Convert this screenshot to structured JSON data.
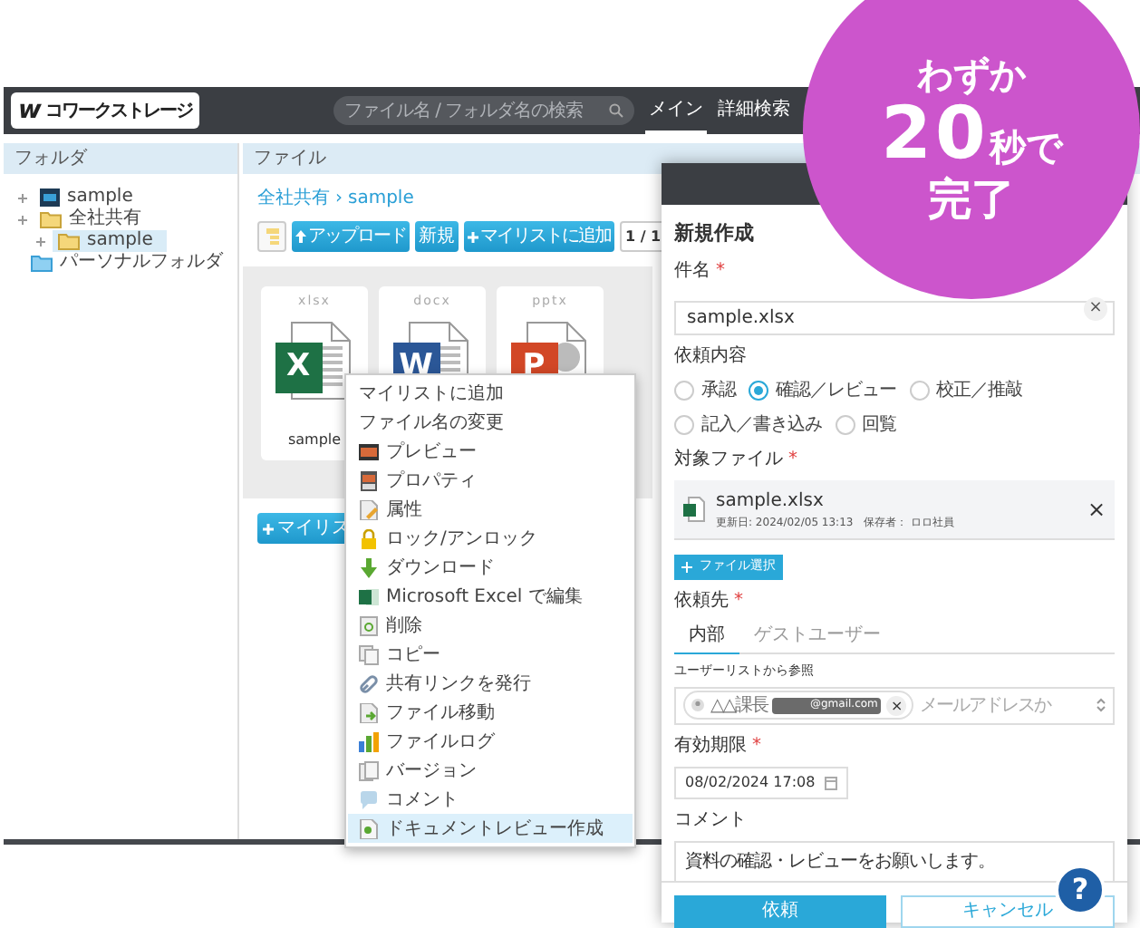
{
  "app": {
    "logo_mark": "w",
    "logo": "コワークストレージ",
    "search": {
      "placeholder": "ファイル名 / フォルダ名の検索"
    },
    "nav_tabs": [
      {
        "label": "メイン",
        "selected": true
      },
      {
        "label": "詳細検索",
        "selected": false
      }
    ]
  },
  "folder_panel": {
    "title": "フォルダ",
    "tree": [
      {
        "label": "sample",
        "kind": "root",
        "selected": false
      },
      {
        "label": "全社共有",
        "kind": "folder",
        "selected": false,
        "children": [
          {
            "label": "sample",
            "kind": "folder",
            "selected": true
          }
        ]
      },
      {
        "label": "パーソナルフォルダ",
        "kind": "personal",
        "selected": false
      }
    ]
  },
  "file_panel": {
    "title": "ファイル",
    "breadcrumb": {
      "items": [
        "全社共有",
        "sample"
      ],
      "separator": "›"
    },
    "toolbar": [
      {
        "kind": "icon"
      },
      {
        "kind": "upload",
        "label": "アップロード"
      },
      {
        "kind": "plain",
        "label": "新規"
      },
      {
        "kind": "add",
        "label": "マイリストに追加"
      }
    ],
    "pager": "1 / 1",
    "files": [
      {
        "ext": "xlsx",
        "kind": "excel",
        "letter": "X",
        "name": "sample"
      },
      {
        "ext": "docx",
        "kind": "word",
        "letter": "W"
      },
      {
        "ext": "pptx",
        "kind": "powerpoint",
        "letter": "P"
      }
    ],
    "mylist_button": "マイリス"
  },
  "context_menu": [
    {
      "label": "マイリストに追加",
      "kind": "none",
      "selected": false
    },
    {
      "label": "ファイル名の変更",
      "kind": "none",
      "selected": false
    },
    {
      "label": "プレビュー",
      "kind": "preview",
      "selected": false
    },
    {
      "label": "プロパティ",
      "kind": "property",
      "selected": false
    },
    {
      "label": "属性",
      "kind": "attribute",
      "selected": false
    },
    {
      "label": "ロック/アンロック",
      "kind": "lock",
      "selected": false
    },
    {
      "label": "ダウンロード",
      "kind": "download",
      "selected": false
    },
    {
      "label": "Microsoft Excel で編集",
      "kind": "excel",
      "selected": false
    },
    {
      "label": "削除",
      "kind": "delete",
      "selected": false
    },
    {
      "label": "コピー",
      "kind": "copy",
      "selected": false
    },
    {
      "label": "共有リンクを発行",
      "kind": "link",
      "selected": false
    },
    {
      "label": "ファイル移動",
      "kind": "move",
      "selected": false
    },
    {
      "label": "ファイルログ",
      "kind": "log",
      "selected": false
    },
    {
      "label": "バージョン",
      "kind": "version",
      "selected": false
    },
    {
      "label": "コメント",
      "kind": "comment",
      "selected": false
    },
    {
      "label": "ドキュメントレビュー作成",
      "kind": "review",
      "selected": true
    }
  ],
  "request_form": {
    "title": "新規作成",
    "required_mark": "*",
    "subject": {
      "label": "件名",
      "required": true,
      "value": "sample.xlsx",
      "clear": "×"
    },
    "request_type": {
      "label": "依頼内容",
      "options": [
        {
          "label": "承認",
          "selected": false
        },
        {
          "label": "確認／レビュー",
          "selected": true
        },
        {
          "label": "校正／推敲",
          "selected": false
        },
        {
          "label": "記入／書き込み",
          "selected": false
        },
        {
          "label": "回覧",
          "selected": false
        }
      ]
    },
    "target_file": {
      "label": "対象ファイル",
      "required": true,
      "name": "sample.xlsx",
      "meta": "更新日: 2024/02/05 13:13　保存者： ロロ社員",
      "remove": "×",
      "select_button": "ファイル選択"
    },
    "recipient": {
      "label": "依頼先",
      "required": true,
      "tabs": [
        {
          "label": "内部",
          "selected": true
        },
        {
          "label": "ゲストユーザー",
          "selected": false
        }
      ],
      "sublabel": "ユーザーリストから参照",
      "chip": {
        "name": "△△課長",
        "email": "@gmail.com",
        "remove": "×"
      },
      "placeholder": "メールアドレスか"
    },
    "deadline": {
      "label": "有効期限",
      "required": true,
      "value": "08/02/2024 17:08"
    },
    "comment": {
      "label": "コメント",
      "value": "資料の確認・レビューをお願いします。"
    },
    "buttons": [
      {
        "label": "依頼",
        "kind": "primary"
      },
      {
        "label": "キャンセル",
        "kind": "secondary"
      }
    ]
  },
  "badge": {
    "line1": "わずか",
    "number": "20",
    "unit": "秒で",
    "line3": "完了"
  },
  "help_button": {
    "label": "?"
  }
}
